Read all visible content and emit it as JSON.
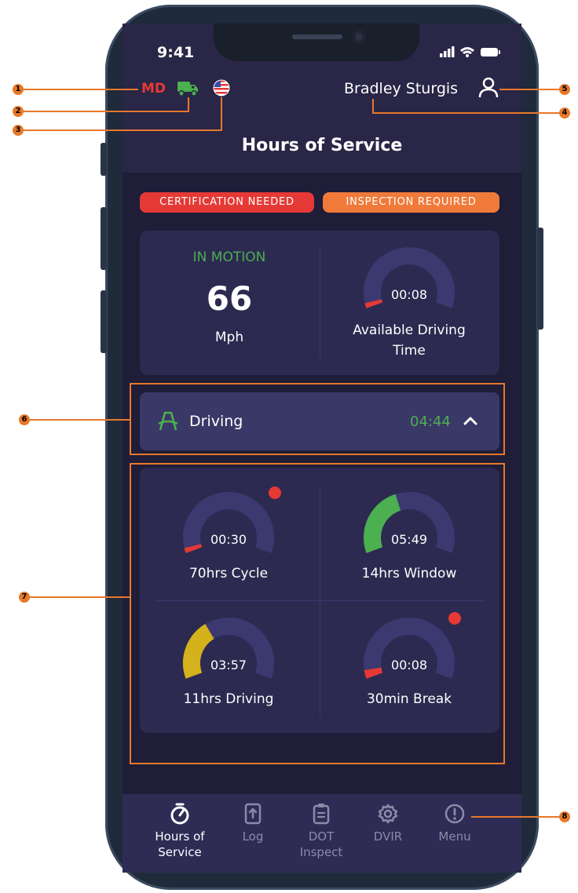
{
  "status_bar": {
    "time": "9:41"
  },
  "header": {
    "jurisdiction": "MD",
    "driver_name": "Bradley Sturgis",
    "title": "Hours of Service",
    "icons": [
      "truck-icon",
      "us-flag-icon",
      "user-icon"
    ]
  },
  "badges": [
    {
      "label": "CERTIFICATION NEEDED",
      "color": "#e53935"
    },
    {
      "label": "INSPECTION REQUIRED",
      "color": "#f07a3a"
    }
  ],
  "motion": {
    "status": "IN MOTION",
    "speed": "66",
    "unit": "Mph"
  },
  "available": {
    "time": "00:08",
    "label": "Available Driving Time",
    "fraction": 0.03
  },
  "duty": {
    "status": "Driving",
    "time": "04:44"
  },
  "gauges": [
    {
      "time": "00:30",
      "label": "70hrs Cycle",
      "fraction": 0.03,
      "color": "#e53935",
      "alert": true
    },
    {
      "time": "05:49",
      "label": "14hrs Window",
      "fraction": 0.42,
      "color": "#4caf50",
      "alert": false
    },
    {
      "time": "03:57",
      "label": "11hrs Driving",
      "fraction": 0.36,
      "color": "#d4b21c",
      "alert": false
    },
    {
      "time": "00:08",
      "label": "30min Break",
      "fraction": 0.05,
      "color": "#e53935",
      "alert": true
    }
  ],
  "nav": [
    {
      "label": "Hours of Service",
      "active": true
    },
    {
      "label": "Log",
      "active": false
    },
    {
      "label": "DOT Inspect",
      "active": false
    },
    {
      "label": "DVIR",
      "active": false
    },
    {
      "label": "Menu",
      "active": false
    }
  ],
  "annotations": [
    "1",
    "2",
    "3",
    "4",
    "5",
    "6",
    "7",
    "8"
  ],
  "colors": {
    "accent_green": "#4caf50",
    "track": "#3b3970",
    "annotation": "#e8782a"
  }
}
